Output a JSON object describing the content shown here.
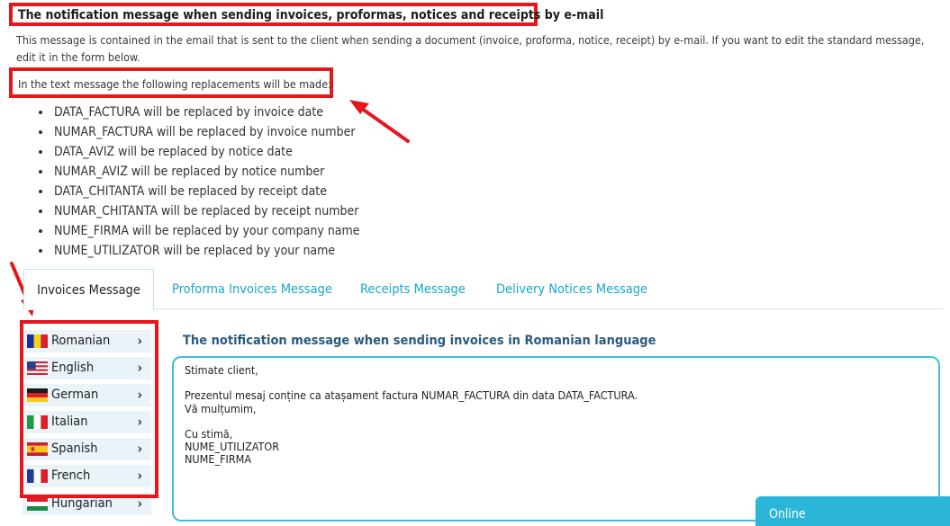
{
  "header": {
    "title": "The notification message when sending invoices, proformas, notices and receipts by e-mail",
    "description": "This message is contained in the email that is sent to the client when sending a document (invoice, proforma, notice, receipt) by e-mail. If you want to edit the standard message, edit it in the form below."
  },
  "replacements": {
    "intro": "In the text message the following replacements will be made:",
    "items": [
      "DATA_FACTURA will be replaced by invoice date",
      "NUMAR_FACTURA will be replaced by invoice number",
      "DATA_AVIZ will be replaced by notice date",
      "NUMAR_AVIZ will be replaced by notice number",
      "DATA_CHITANTA will be replaced by receipt date",
      "NUMAR_CHITANTA will be replaced by receipt number",
      "NUME_FIRMA will be replaced by your company name",
      "NUME_UTILIZATOR will be replaced by your name"
    ]
  },
  "tabs": [
    {
      "label": "Invoices Message",
      "active": true
    },
    {
      "label": "Proforma Invoices Message"
    },
    {
      "label": "Receipts Message"
    },
    {
      "label": "Delivery Notices Message"
    }
  ],
  "languages": [
    {
      "label": "Romanian",
      "flag": "flag-ro"
    },
    {
      "label": "English",
      "flag": "flag-us"
    },
    {
      "label": "German",
      "flag": "flag-de"
    },
    {
      "label": "Italian",
      "flag": "flag-it"
    },
    {
      "label": "Spanish",
      "flag": "flag-es"
    },
    {
      "label": "French",
      "flag": "flag-fr"
    },
    {
      "label": "Hungarian",
      "flag": "flag-hu"
    }
  ],
  "chevron": "›",
  "message": {
    "title": "The notification message when sending invoices in Romanian language",
    "body": "Stimate client,\n\nPrezentul mesaj conține ca atașament factura NUMAR_FACTURA din data DATA_FACTURA.\nVă mulțumim,\n\nCu stimă,\nNUME_UTILIZATOR\nNUME_FIRMA"
  },
  "online": {
    "label": "Online"
  },
  "colors": {
    "highlight": "#e8151b",
    "accent": "#17a7c7",
    "title": "#2a5a7e"
  }
}
